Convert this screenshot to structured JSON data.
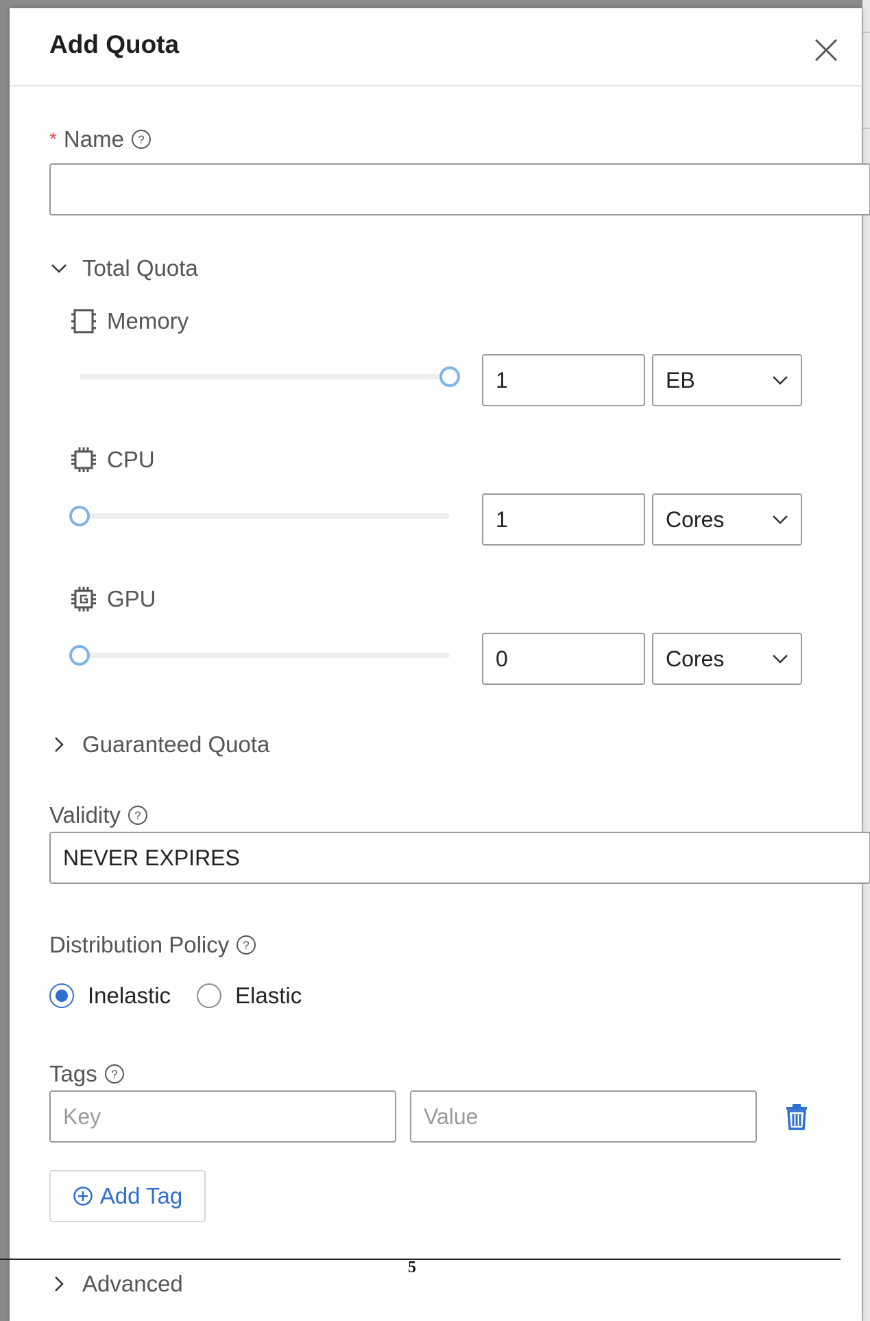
{
  "dialog": {
    "title": "Add Quota"
  },
  "name": {
    "required_mark": "*",
    "label": "Name",
    "value": ""
  },
  "total_quota": {
    "label": "Total Quota",
    "expanded": true,
    "memory": {
      "label": "Memory",
      "value": "1",
      "unit": "EB",
      "slider_fraction": 1.0
    },
    "cpu": {
      "label": "CPU",
      "value": "1",
      "unit": "Cores",
      "slider_fraction": 0.0
    },
    "gpu": {
      "label": "GPU",
      "value": "0",
      "unit": "Cores",
      "slider_fraction": 0.0
    }
  },
  "guaranteed_quota": {
    "label": "Guaranteed Quota",
    "expanded": false
  },
  "validity": {
    "label": "Validity",
    "value": "NEVER EXPIRES"
  },
  "distribution_policy": {
    "label": "Distribution Policy",
    "options": [
      "Inelastic",
      "Elastic"
    ],
    "selected": "Inelastic"
  },
  "tags": {
    "label": "Tags",
    "key_placeholder": "Key",
    "value_placeholder": "Value",
    "add_label": "Add Tag"
  },
  "advanced": {
    "label": "Advanced",
    "expanded": false
  },
  "page_number": "5",
  "colors": {
    "accent": "#2f6fcf",
    "slider": "#7fb4e8",
    "required": "#d9534f"
  }
}
